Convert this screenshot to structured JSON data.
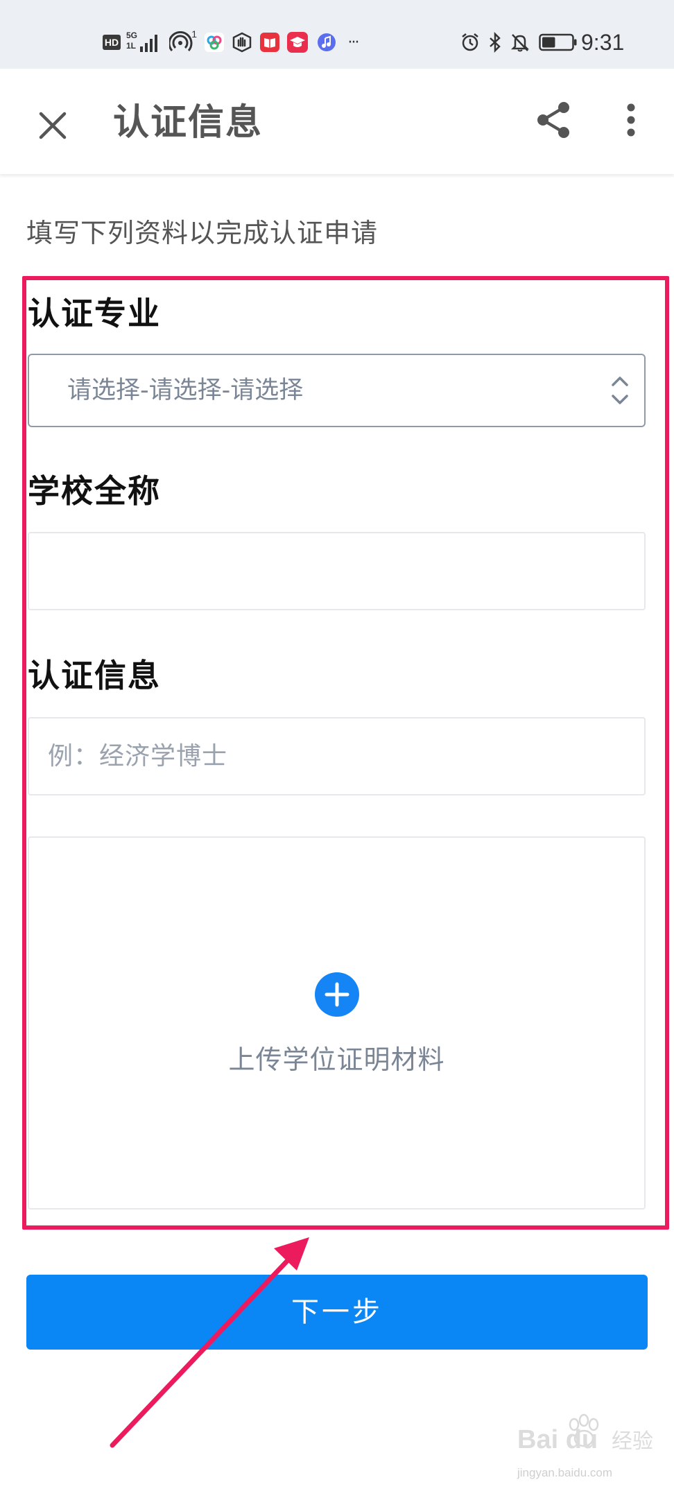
{
  "status_bar": {
    "hd_label": "HD",
    "network_top": "5G",
    "network_bottom": "1L",
    "hotspot_sup": "1",
    "more_indicator": "···",
    "time": "9:31",
    "battery_level": 0.45,
    "left_icons": [
      "hd-icon",
      "signal-icon",
      "hotspot-icon",
      "colorful-app-icon",
      "hand-app-icon",
      "book-app-icon",
      "graduation-cap-app-icon",
      "music-app-icon"
    ],
    "right_icons": [
      "alarm-icon",
      "bluetooth-icon",
      "mute-icon",
      "battery-icon"
    ]
  },
  "header": {
    "title": "认证信息",
    "close_icon": "close-icon",
    "share_icon": "share-icon",
    "more_icon": "more-vertical-icon"
  },
  "intro": "填写下列资料以完成认证申请",
  "form": {
    "major_label": "认证专业",
    "major_select_value": "请选择-请选择-请选择",
    "school_label": "学校全称",
    "school_value": "",
    "cert_label": "认证信息",
    "cert_placeholder": "例：经济学博士",
    "upload_label": "上传学位证明材料",
    "upload_icon": "plus-circle-icon"
  },
  "next_button": "下一步",
  "annotation": {
    "highlight_color": "#eb1b5e",
    "arrow_color": "#eb1b5e"
  },
  "watermark": {
    "brand": "Bai du",
    "brand_cn": "经验",
    "url": "jingyan.baidu.com"
  },
  "colors": {
    "accent": "#0b86f5",
    "status_bar_bg": "#eceff3"
  }
}
